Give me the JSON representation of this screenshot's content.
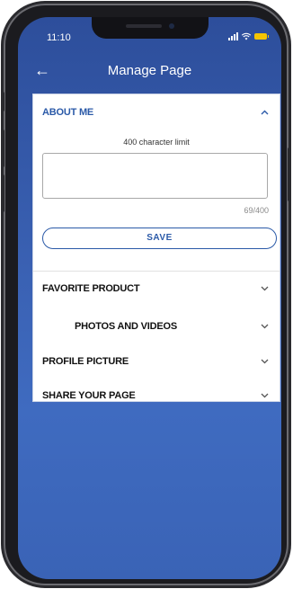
{
  "status_bar": {
    "time": "11:10"
  },
  "header": {
    "title": "Manage Page",
    "back_icon": "arrow-left-icon"
  },
  "about_me": {
    "title": "ABOUT ME",
    "char_limit_text": "400 character limit",
    "text_value": "",
    "counter": "69/400",
    "save_label": "SAVE"
  },
  "sections": [
    {
      "label": "FAVORITE PRODUCT"
    },
    {
      "label": "PHOTOS AND VIDEOS"
    },
    {
      "label": "PROFILE PICTURE"
    },
    {
      "label": "SHARE YOUR PAGE"
    }
  ],
  "colors": {
    "accent": "#2b5aa8",
    "background_top": "#2d4e9b",
    "background_bottom": "#3f6bc0",
    "battery": "#f5c400"
  }
}
